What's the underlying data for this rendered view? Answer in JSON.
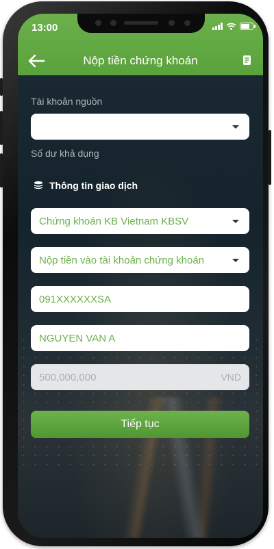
{
  "status": {
    "time": "13:00"
  },
  "header": {
    "title": "Nộp tiền chứng khoán"
  },
  "form": {
    "source_account_label": "Tài khoản nguồn",
    "source_account_value": "",
    "available_balance_label": "Số dư khả dụng",
    "section_title": "Thông tin giao dịch",
    "broker_value": "Chứng khoán KB Vietnam KBSV",
    "method_value": "Nộp tiền vào tài khoản chứng khoán",
    "account_number": "091XXXXXXSA",
    "account_name": "NGUYEN VAN A",
    "amount": "500,000,000",
    "currency": "VND",
    "continue_label": "Tiếp tục"
  },
  "colors": {
    "accent": "#5aa23c",
    "field_text": "#6cb14a"
  },
  "icons": [
    "back-arrow-icon",
    "document-icon",
    "coins-icon",
    "chevron-down-icon"
  ]
}
